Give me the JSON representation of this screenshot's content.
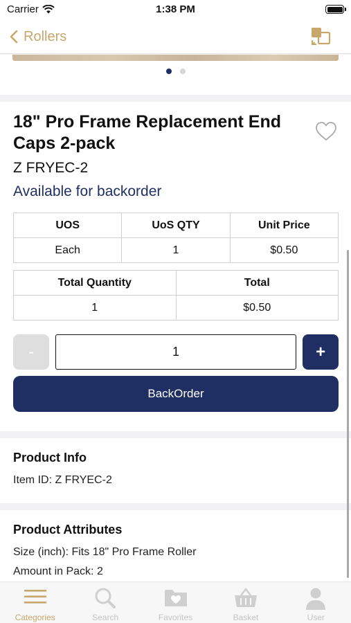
{
  "status_bar": {
    "carrier": "Carrier",
    "time": "1:38 PM"
  },
  "nav": {
    "back_label": "Rollers",
    "action_icon": "catalog-switch-icon"
  },
  "gallery": {
    "page_count": 2,
    "active_page": 1
  },
  "product": {
    "title": "18\" Pro Frame Replacement End Caps 2-pack",
    "sku": "Z FRYEC-2",
    "availability": "Available for backorder",
    "uos_table": {
      "headers": [
        "UOS",
        "UoS QTY",
        "Unit Price"
      ],
      "row": [
        "Each",
        "1",
        "$0.50"
      ]
    },
    "total_table": {
      "headers": [
        "Total Quantity",
        "Total"
      ],
      "row": [
        "1",
        "$0.50"
      ]
    },
    "quantity": {
      "minus_label": "-",
      "value": "1",
      "plus_label": "+"
    },
    "backorder_label": "BackOrder"
  },
  "product_info": {
    "title": "Product Info",
    "item_id": "Item ID: Z FRYEC-2"
  },
  "product_attributes": {
    "title": "Product Attributes",
    "lines": [
      "Size (inch): Fits 18\" Pro Frame Roller",
      "Amount in Pack: 2"
    ]
  },
  "tab_bar": {
    "tabs": [
      {
        "label": "Categories",
        "icon": "categories-icon",
        "active": true
      },
      {
        "label": "Search",
        "icon": "search-icon",
        "active": false
      },
      {
        "label": "Favorites",
        "icon": "favorites-folder-icon",
        "active": false
      },
      {
        "label": "Basket",
        "icon": "basket-icon",
        "active": false
      },
      {
        "label": "User",
        "icon": "user-icon",
        "active": false
      }
    ]
  },
  "colors": {
    "accent_gold": "#c7a76a",
    "navy": "#1f2f63",
    "disabled": "#dedede"
  }
}
